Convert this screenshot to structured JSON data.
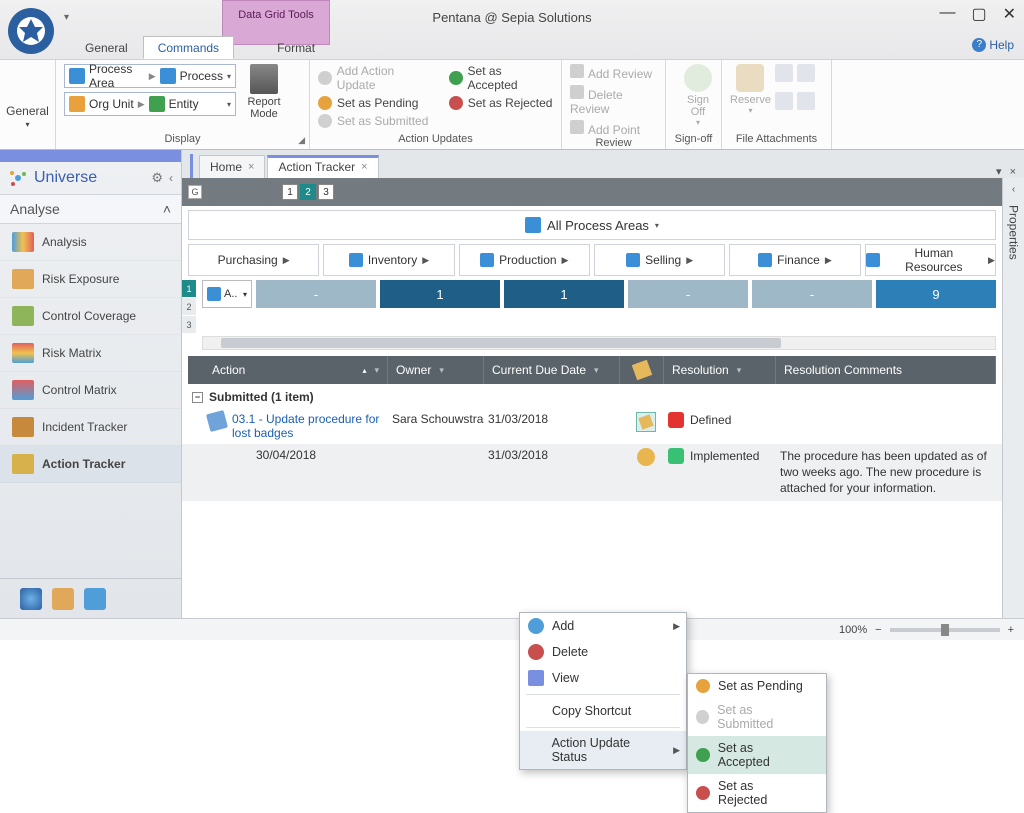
{
  "app": {
    "title": "Pentana @ Sepia Solutions",
    "help": "Help"
  },
  "context_tool": "Data Grid Tools",
  "ribbon_tabs": {
    "general": "General",
    "commands": "Commands",
    "format": "Format"
  },
  "ribbon": {
    "general_drop": "General",
    "display": {
      "label": "Display",
      "row1a": "Process Area",
      "row1b": "Process",
      "row2a": "Org Unit",
      "row2b": "Entity",
      "report_mode": "Report\nMode"
    },
    "updates": {
      "label": "Action Updates",
      "add": "Add Action Update",
      "pending": "Set as Pending",
      "submitted": "Set as Submitted",
      "accepted": "Set as Accepted",
      "rejected": "Set as Rejected"
    },
    "review": {
      "label": "Review",
      "add": "Add Review",
      "delete": "Delete Review",
      "point": "Add Point"
    },
    "signoff": {
      "label": "Sign-off",
      "btn": "Sign\nOff"
    },
    "attach": {
      "label": "File Attachments",
      "reserve": "Reserve"
    }
  },
  "sidebar": {
    "title": "Universe",
    "section": "Analyse",
    "items": [
      {
        "label": "Analysis"
      },
      {
        "label": "Risk Exposure"
      },
      {
        "label": "Control Coverage"
      },
      {
        "label": "Risk Matrix"
      },
      {
        "label": "Control Matrix"
      },
      {
        "label": "Incident Tracker"
      },
      {
        "label": "Action Tracker"
      }
    ]
  },
  "tabs": {
    "home": "Home",
    "tracker": "Action Tracker"
  },
  "properties": "Properties",
  "pager": [
    "1",
    "2",
    "3"
  ],
  "all_areas": "All Process Areas",
  "areas": [
    "Purchasing",
    "Inventory",
    "Production",
    "Selling",
    "Finance",
    "Human Resources"
  ],
  "metrics": {
    "a_label": "A..",
    "cells": [
      "-",
      "1",
      "1",
      "-",
      "-",
      "9"
    ]
  },
  "grid": {
    "headers": {
      "action": "Action",
      "owner": "Owner",
      "due": "Current Due Date",
      "res": "Resolution",
      "com": "Resolution Comments"
    },
    "group": "Submitted (1 item)",
    "rows": [
      {
        "action": "03.1 - Update procedure for lost badges",
        "owner": "Sara Schouwstra",
        "due": "31/03/2018",
        "res": "Defined",
        "res_color": "red"
      },
      {
        "action_date": "30/04/2018",
        "due": "31/03/2018",
        "res": "Implemented",
        "res_color": "green",
        "com": "The procedure has been updated as of two weeks ago. The new procedure is attached for your information."
      }
    ]
  },
  "ctx": {
    "add": "Add",
    "delete": "Delete",
    "view": "View",
    "copy": "Copy Shortcut",
    "status": "Action Update Status",
    "pending": "Set as Pending",
    "submitted": "Set as Submitted",
    "accepted": "Set as Accepted",
    "rejected": "Set as Rejected"
  },
  "status": {
    "zoom": "100%"
  }
}
